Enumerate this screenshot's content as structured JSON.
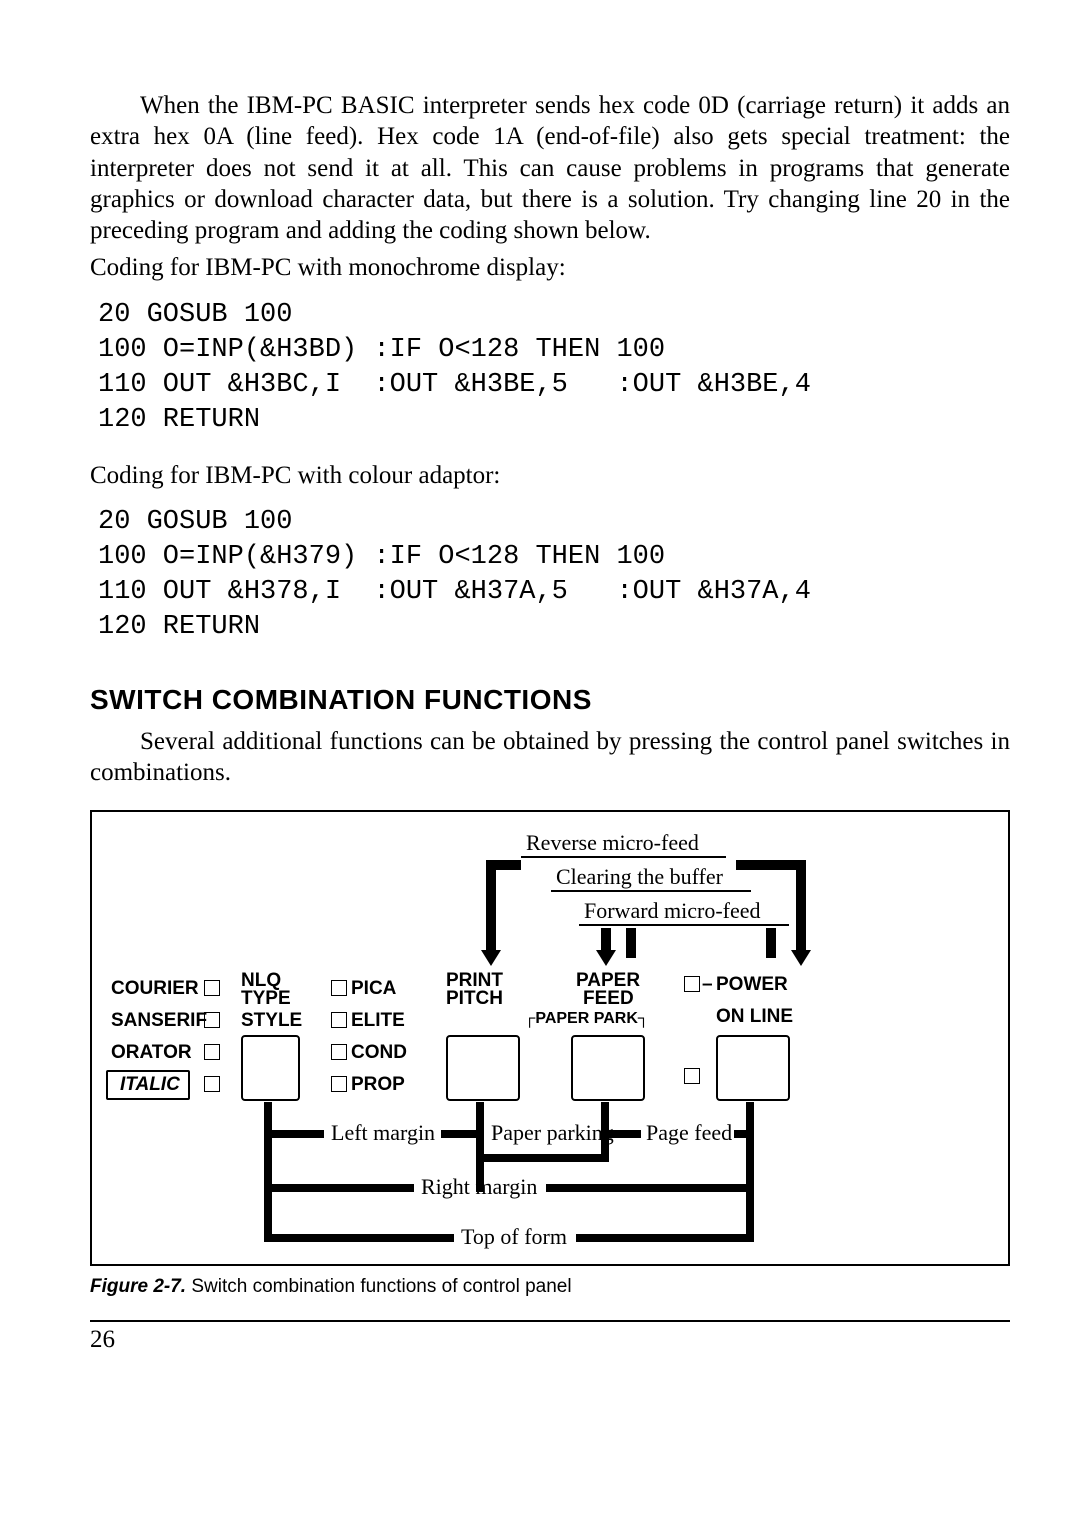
{
  "paragraphs": {
    "p1": "When the IBM-PC BASIC interpreter sends hex code 0D (carriage return) it adds an extra hex 0A (line feed). Hex code 1A (end-of-file) also gets special treatment: the interpreter does not send it at all. This can cause problems in programs that generate graphics or download character data, but there is a solution. Try changing line 20 in the preceding program and adding the coding shown below.",
    "p2": "Coding for IBM-PC with monochrome display:",
    "p3": "Coding for IBM-PC with colour adaptor:",
    "p4": "Several additional functions can be obtained by pressing the control panel switches in combinations."
  },
  "code": {
    "mono": "20 GOSUB 100\n100 O=INP(&H3BD) :IF O<128 THEN 100\n110 OUT &H3BC,I  :OUT &H3BE,5   :OUT &H3BE,4\n120 RETURN",
    "color": "20 GOSUB 100\n100 O=INP(&H379) :IF O<128 THEN 100\n110 OUT &H378,I  :OUT &H37A,5   :OUT &H37A,4\n120 RETURN"
  },
  "heading": "SWITCH COMBINATION FUNCTIONS",
  "figure": {
    "caption_bold": "Figure 2-7.",
    "caption_rest": " Switch combination functions of control panel",
    "top_labels": {
      "reverse": "Reverse micro-feed",
      "clearing": "Clearing the buffer",
      "forward": "Forward micro-feed"
    },
    "panel": {
      "courier": "COURIER",
      "sanserif": "SANSERIF",
      "orator": "ORATOR",
      "italic": "ITALIC",
      "nlq1": "NLQ",
      "nlq2": "TYPE",
      "style": "STYLE",
      "pica": "PICA",
      "elite": "ELITE",
      "cond": "COND",
      "prop": "PROP",
      "print1": "PRINT",
      "print2": "PITCH",
      "paperpark": "PAPER PARK",
      "paper1": "PAPER",
      "paper2": "FEED",
      "power": "POWER",
      "online": "ON LINE",
      "dash": "–"
    },
    "bottom_labels": {
      "left_margin": "Left margin",
      "paper_parking": "Paper parking",
      "page_feed": "Page feed",
      "right_margin": "Right margin",
      "top_of_form": "Top of form"
    }
  },
  "page_number": "26"
}
